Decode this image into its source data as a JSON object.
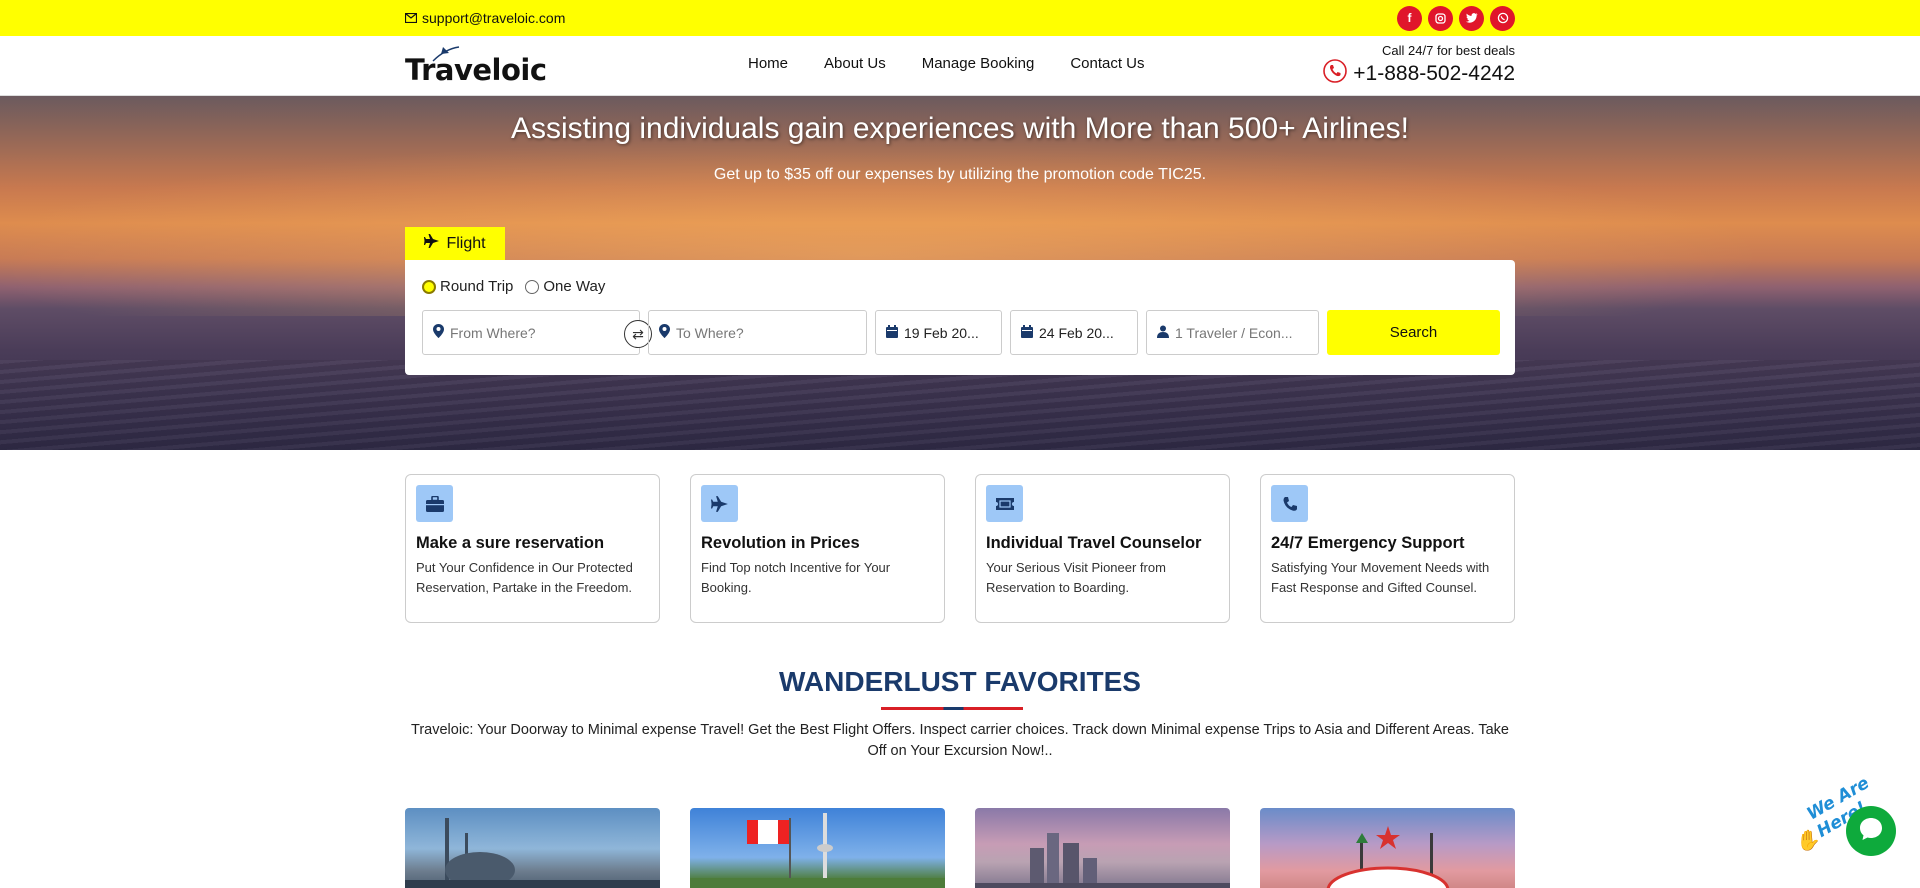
{
  "topbar": {
    "email": "support@traveloic.com",
    "socials": [
      "facebook-icon",
      "instagram-icon",
      "twitter-icon",
      "whatsapp-icon"
    ]
  },
  "header": {
    "logo_text": "Traveloic",
    "nav": [
      {
        "label": "Home"
      },
      {
        "label": "About Us"
      },
      {
        "label": "Manage Booking"
      },
      {
        "label": "Contact Us"
      }
    ],
    "call_label": "Call 24/7 for best deals",
    "phone": "+1-888-502-4242"
  },
  "hero": {
    "title": "Assisting individuals gain experiences with More than 500+ Airlines!",
    "subtitle": "Get up to $35 off our expenses by utilizing the promotion code TIC25."
  },
  "search": {
    "tab_label": "Flight",
    "trip_types": [
      {
        "label": "Round Trip",
        "selected": true
      },
      {
        "label": "One Way",
        "selected": false
      }
    ],
    "from_placeholder": "From Where?",
    "to_placeholder": "To Where?",
    "depart_date": "19 Feb 20...",
    "return_date": "24 Feb 20...",
    "travelers": "1 Traveler / Econ...",
    "search_button": "Search"
  },
  "features": [
    {
      "icon": "briefcase-icon",
      "title": "Make a sure reservation",
      "text": "Put Your Confidence in Our Protected Reservation, Partake in the Freedom."
    },
    {
      "icon": "plane-icon",
      "title": "Revolution in Prices",
      "text": "Find Top notch Incentive for Your Booking."
    },
    {
      "icon": "ticket-icon",
      "title": "Individual Travel Counselor",
      "text": "Your Serious Visit Pioneer from Reservation to Boarding."
    },
    {
      "icon": "phone-icon",
      "title": "24/7 Emergency Support",
      "text": "Satisfying Your Movement Needs with Fast Response and Gifted Counsel."
    }
  ],
  "wanderlust": {
    "title": "WANDERLUST FAVORITES",
    "text": "Traveloic: Your Doorway to Minimal expense Travel! Get the Best Flight Offers. Inspect carrier choices. Track down Minimal expense Trips to Asia and Different Areas. Take Off on Your Excursion Now!.."
  },
  "chat": {
    "badge": "We Are Here!"
  },
  "colors": {
    "accent_yellow": "#ffff00",
    "social_red": "#e0162b",
    "heading_blue": "#1a3a6b",
    "icon_bg": "#9ec8f7",
    "chat_green": "#0eaa3c"
  }
}
